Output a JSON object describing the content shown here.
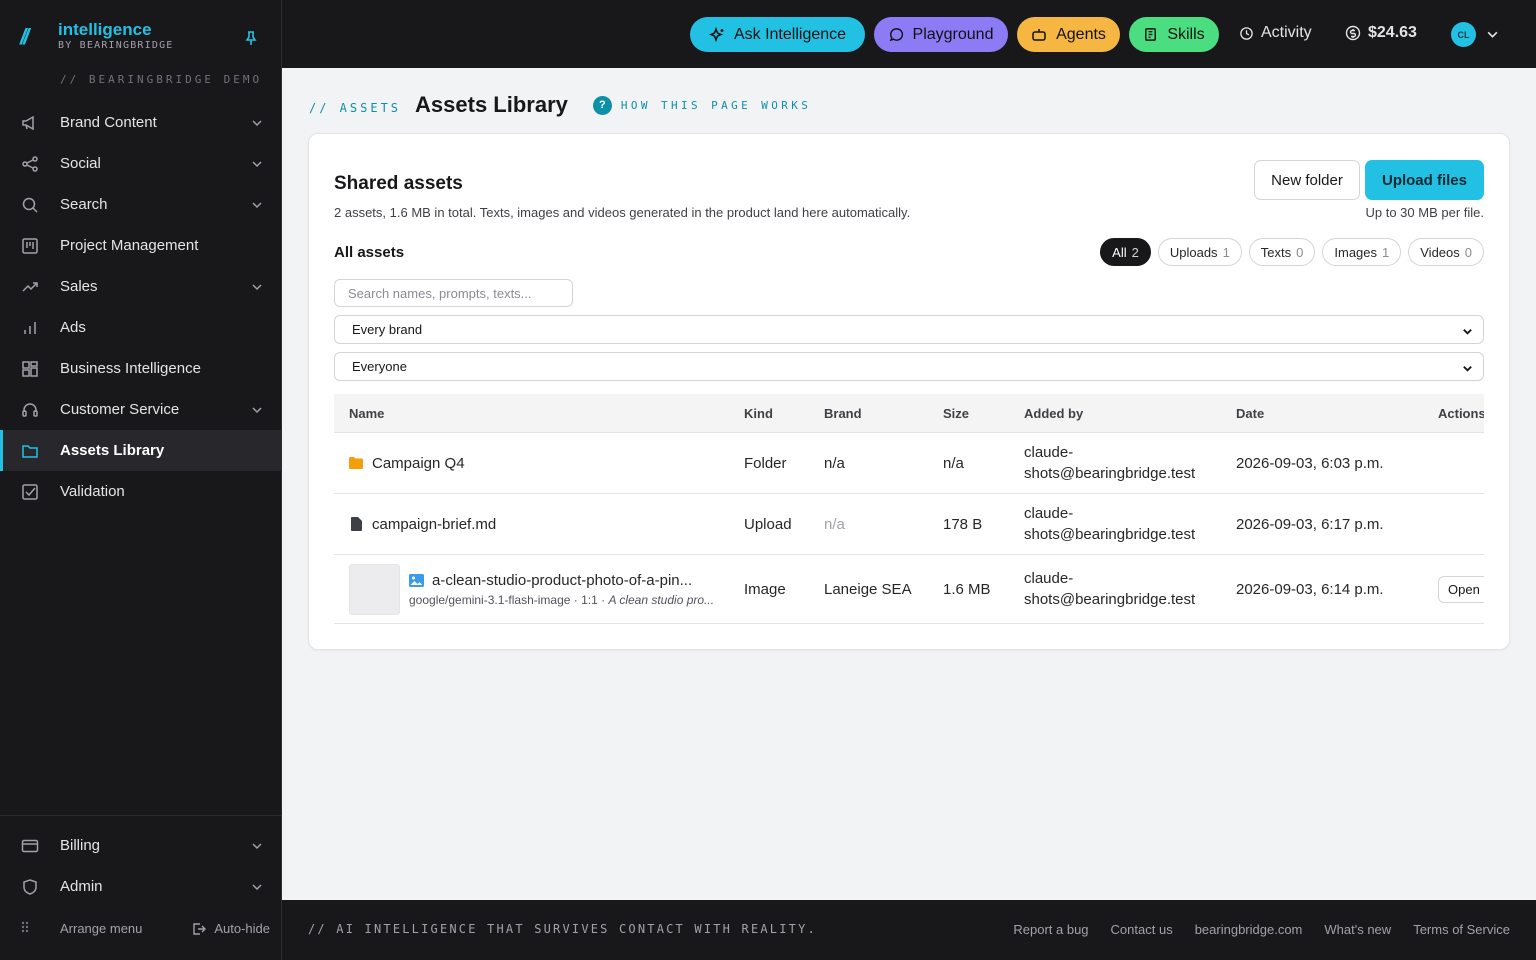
{
  "brand": {
    "mark": "//",
    "name": "intelligence",
    "byline": "BY BEARINGBRIDGE",
    "demo_label": "// BEARINGBRIDGE DEMO"
  },
  "sidebar": {
    "items": [
      {
        "label": "Brand Content",
        "icon": "megaphone-icon"
      },
      {
        "label": "Social",
        "icon": "share-icon"
      },
      {
        "label": "Search",
        "icon": "search-icon"
      },
      {
        "label": "Project Management",
        "icon": "kanban-icon"
      },
      {
        "label": "Sales",
        "icon": "trend-up-icon"
      },
      {
        "label": "Ads",
        "icon": "bar-chart-icon"
      },
      {
        "label": "Business Intelligence",
        "icon": "dashboard-icon"
      },
      {
        "label": "Customer Service",
        "icon": "headset-icon"
      },
      {
        "label": "Assets Library",
        "icon": "folder-icon",
        "active": true
      },
      {
        "label": "Validation",
        "icon": "check-square-icon"
      }
    ],
    "bottom_items": [
      {
        "label": "Billing",
        "icon": "credit-card-icon"
      },
      {
        "label": "Admin",
        "icon": "shield-icon"
      }
    ],
    "arrange_menu": "Arrange menu",
    "auto_hide": "Auto-hide"
  },
  "topbar": {
    "ask": "Ask Intelligence",
    "playground": "Playground",
    "agents": "Agents",
    "skills": "Skills",
    "activity": "Activity",
    "balance": "$24.63",
    "avatar_initials": "CL",
    "colors": {
      "ask": "#22c1e3",
      "playground": "#8b7cf6",
      "agents": "#f5b642",
      "skills": "#4ade80"
    }
  },
  "page": {
    "crumb": "// ASSETS",
    "title": "Assets Library",
    "help_badge": "?",
    "help": "HOW THIS PAGE WORKS"
  },
  "card": {
    "title": "Shared assets",
    "subtitle": "2 assets, 1.6 MB in total. Texts, images and videos generated in the product land here automatically.",
    "new_folder": "New folder",
    "upload_files": "Upload files",
    "upload_note": "Up to 30 MB per file.",
    "section_title": "All assets",
    "filters": [
      {
        "label": "All",
        "count": "2",
        "active": true
      },
      {
        "label": "Uploads",
        "count": "1"
      },
      {
        "label": "Texts",
        "count": "0"
      },
      {
        "label": "Images",
        "count": "1"
      },
      {
        "label": "Videos",
        "count": "0"
      }
    ],
    "search_placeholder": "Search names, prompts, texts...",
    "brand_select": "Every brand",
    "person_select": "Everyone"
  },
  "table": {
    "headers": [
      "Name",
      "Kind",
      "Brand",
      "Size",
      "Added by",
      "Date",
      "Actions"
    ],
    "rows": [
      {
        "name": "Campaign Q4",
        "kind": "Folder",
        "brand": "n/a",
        "size": "n/a",
        "added_by_1": "claude-",
        "added_by_2": "shots@bearingbridge.test",
        "date": "2026-09-03, 6:03 p.m."
      },
      {
        "name": "campaign-brief.md",
        "kind": "Upload",
        "brand": "n/a",
        "size": "178 B",
        "added_by_1": "claude-",
        "added_by_2": "shots@bearingbridge.test",
        "date": "2026-09-03, 6:17 p.m."
      },
      {
        "name": "a-clean-studio-product-photo-of-a-pin...",
        "meta": "google/gemini-3.1-flash-image · 1:1 · ",
        "meta_prompt": "A clean studio pro...",
        "kind": "Image",
        "brand": "Laneige SEA",
        "size": "1.6 MB",
        "added_by_1": "claude-",
        "added_by_2": "shots@bearingbridge.test",
        "date": "2026-09-03, 6:14 p.m.",
        "action": "Open"
      }
    ]
  },
  "footer": {
    "tagline": "// AI INTELLIGENCE THAT SURVIVES CONTACT WITH REALITY.",
    "links": [
      "Report a bug",
      "Contact us",
      "bearingbridge.com",
      "What's new",
      "Terms of Service"
    ]
  }
}
